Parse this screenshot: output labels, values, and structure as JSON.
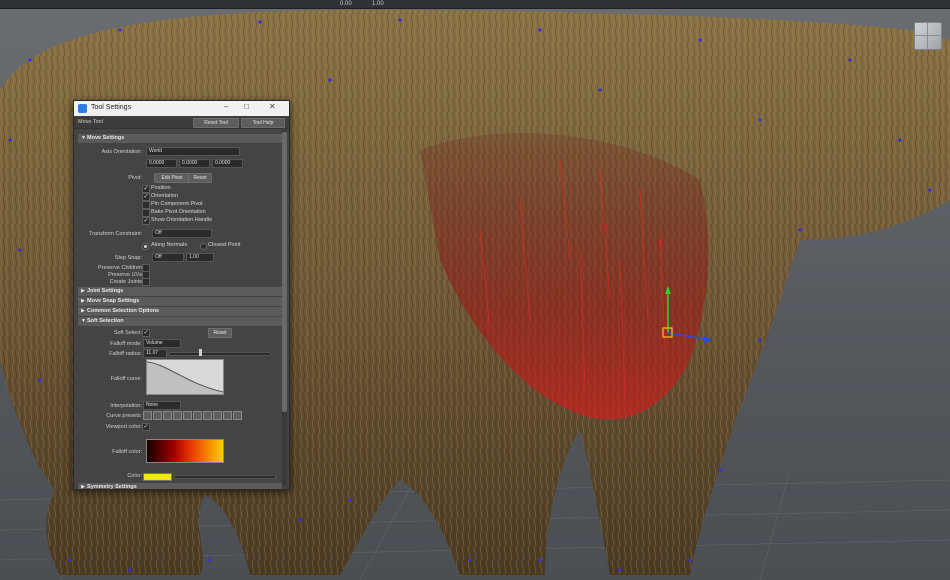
{
  "viewport": {
    "status_values": [
      "0.00",
      "1.00"
    ]
  },
  "tool_settings": {
    "title": "Tool Settings",
    "tool_name": "Move Tool",
    "reset_tool": "Reset Tool",
    "tool_help": "Tool Help",
    "sections": {
      "move_settings": "Move Settings",
      "joint_settings": "Joint Settings",
      "move_snap": "Move Snap Settings",
      "common_selection": "Common Selection Options",
      "soft_selection": "Soft Selection",
      "symmetry": "Symmetry Settings"
    },
    "axis_orientation_label": "Axis Orientation:",
    "axis_orientation_value": "World",
    "xyz": [
      "0.0000",
      "0.0000",
      "0.0000"
    ],
    "pivot_label": "Pivot:",
    "edit_pivot": "Edit Pivot",
    "reset_pivot": "Reset",
    "pivot_options": [
      {
        "label": "Position",
        "checked": true
      },
      {
        "label": "Orientation",
        "checked": true
      },
      {
        "label": "Pin Component Pivot",
        "checked": false
      },
      {
        "label": "Bake Pivot Orientation",
        "checked": false
      },
      {
        "label": "Show Orientation Handle",
        "checked": true
      }
    ],
    "transform_constraint_label": "Transform Constraint:",
    "transform_constraint_value": "Off",
    "along_normals": "Along Normals",
    "closest_point": "Closest Point",
    "step_snap_label": "Step Snap:",
    "step_snap_value": "Off",
    "step_snap_num": "1.00",
    "preserve_label_1": "Preserve Children",
    "preserve_label_2": "Preserve UVs",
    "create_label": "Create Joints",
    "soft_select_label": "Soft Select:",
    "soft_reset": "Reset",
    "falloff_mode_label": "Falloff mode:",
    "falloff_mode_value": "Volume",
    "falloff_radius_label": "Falloff radius:",
    "falloff_radius_value": "11.07",
    "falloff_radius_fraction": 0.3,
    "falloff_curve_label": "Falloff curve:",
    "interpolation_label": "Interpolation:",
    "interpolation_value": "None",
    "curve_presets_label": "Curve presets:",
    "viewport_color_label": "Viewport color:",
    "falloff_color_label": "Falloff color:",
    "color_label": "Color:"
  }
}
